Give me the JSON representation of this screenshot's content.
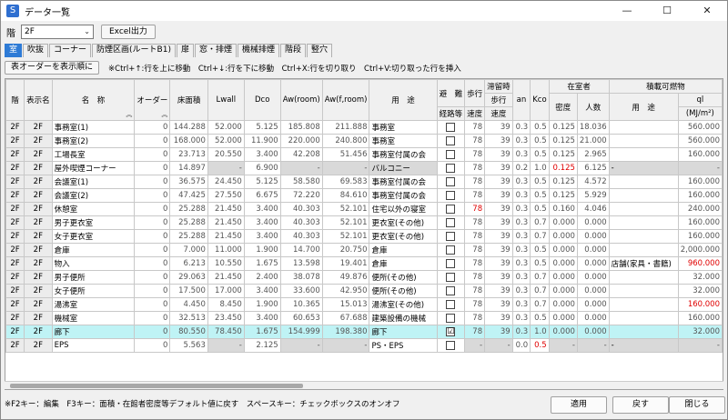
{
  "window": {
    "title": "データ一覧",
    "app_icon": "S"
  },
  "floor": {
    "label": "階",
    "value": "2F",
    "excel_label": "Excel出力"
  },
  "tabs": [
    "室",
    "吹抜",
    "コーナー",
    "防煙区画(ルートB1)",
    "扉",
    "窓・排煙",
    "機械排煙",
    "階段",
    "竪穴"
  ],
  "order_button": "表オーダーを表示順に",
  "hint": "※Ctrl+↑:行を上に移動　Ctrl+↓:行を下に移動　Ctrl+X:行を切り取り　Ctrl+V:切り取った行を挿入",
  "headers": {
    "kai": "階",
    "hyouji": "表示名",
    "meisho": "名　称",
    "order": "オーダー",
    "yuka": "床面積",
    "lwall": "Lwall",
    "dco": "Dco",
    "aw_room": "Aw(room)",
    "aw_froom": "Aw(f,room)",
    "yoto": "用　途",
    "hinan_top": "避　難",
    "keiro": "経路等",
    "hoko_top": "歩行",
    "hoko_bot": "速度",
    "tai_top": "滞留時",
    "tai_mid": "歩行",
    "tai_bot": "速度",
    "an": "an",
    "kco": "Kco",
    "zaishitsu": "在室者",
    "mitsudo": "密度",
    "ninzu": "人数",
    "sekisai": "積載可燃物",
    "sekisai_yoto": "用　途",
    "ql_top": "ql",
    "ql_unit": "(MJ/m²)"
  },
  "rows": [
    {
      "kai": "2F",
      "disp": "2F",
      "name": "事務室(1)",
      "order": "0",
      "yuka": "144.288",
      "lwall": "52.000",
      "dco": "5.125",
      "aw": "185.808",
      "awf": "211.888",
      "yoto": "事務室",
      "cb": "",
      "hoko": "78",
      "tai": "39",
      "an": "0.3",
      "kco": "0.5",
      "mitsudo": "0.125",
      "ninzu": "18.036",
      "s_yoto": "",
      "ql": "560.000"
    },
    {
      "kai": "2F",
      "disp": "2F",
      "name": "事務室(2)",
      "order": "0",
      "yuka": "168.000",
      "lwall": "52.000",
      "dco": "11.900",
      "aw": "220.000",
      "awf": "240.800",
      "yoto": "事務室",
      "cb": "",
      "hoko": "78",
      "tai": "39",
      "an": "0.3",
      "kco": "0.5",
      "mitsudo": "0.125",
      "ninzu": "21.000",
      "s_yoto": "",
      "ql": "560.000"
    },
    {
      "kai": "2F",
      "disp": "2F",
      "name": "工場長室",
      "order": "0",
      "yuka": "23.713",
      "lwall": "20.550",
      "dco": "3.400",
      "aw": "42.208",
      "awf": "51.456",
      "yoto": "事務室付属の会",
      "cb": "",
      "hoko": "78",
      "tai": "39",
      "an": "0.3",
      "kco": "0.5",
      "mitsudo": "0.125",
      "ninzu": "2.965",
      "s_yoto": "",
      "ql": "160.000"
    },
    {
      "kai": "2F",
      "disp": "2F",
      "name": "屋外喫煙コーナー",
      "order": "0",
      "yuka": "14.897",
      "lwall": "-",
      "dco": "6.900",
      "aw": "-",
      "awf": "-",
      "yoto": "バルコニー",
      "cb": "",
      "hoko": "78",
      "tai": "39",
      "an": "0.2",
      "kco": "1.0",
      "mitsudo": "0.125",
      "ninzu": "6.125",
      "s_yoto": "-",
      "ql": "-",
      "grey": true,
      "red_mitsudo": true
    },
    {
      "kai": "2F",
      "disp": "2F",
      "name": "会議室(1)",
      "order": "0",
      "yuka": "36.575",
      "lwall": "24.450",
      "dco": "5.125",
      "aw": "58.580",
      "awf": "69.583",
      "yoto": "事務室付属の会",
      "cb": "",
      "hoko": "78",
      "tai": "39",
      "an": "0.3",
      "kco": "0.5",
      "mitsudo": "0.125",
      "ninzu": "4.572",
      "s_yoto": "",
      "ql": "160.000"
    },
    {
      "kai": "2F",
      "disp": "2F",
      "name": "会議室(2)",
      "order": "0",
      "yuka": "47.425",
      "lwall": "27.550",
      "dco": "6.675",
      "aw": "72.220",
      "awf": "84.610",
      "yoto": "事務室付属の会",
      "cb": "",
      "hoko": "78",
      "tai": "39",
      "an": "0.3",
      "kco": "0.5",
      "mitsudo": "0.125",
      "ninzu": "5.929",
      "s_yoto": "",
      "ql": "160.000"
    },
    {
      "kai": "2F",
      "disp": "2F",
      "name": "休憩室",
      "order": "0",
      "yuka": "25.288",
      "lwall": "21.450",
      "dco": "3.400",
      "aw": "40.303",
      "awf": "52.101",
      "yoto": "住宅以外の寝室",
      "cb": "",
      "hoko": "78",
      "tai": "39",
      "an": "0.3",
      "kco": "0.5",
      "mitsudo": "0.160",
      "ninzu": "4.046",
      "s_yoto": "",
      "ql": "240.000",
      "red_hoko": true
    },
    {
      "kai": "2F",
      "disp": "2F",
      "name": "男子更衣室",
      "order": "0",
      "yuka": "25.288",
      "lwall": "21.450",
      "dco": "3.400",
      "aw": "40.303",
      "awf": "52.101",
      "yoto": "更衣室(その他)",
      "cb": "",
      "hoko": "78",
      "tai": "39",
      "an": "0.3",
      "kco": "0.7",
      "mitsudo": "0.000",
      "ninzu": "0.000",
      "s_yoto": "",
      "ql": "160.000"
    },
    {
      "kai": "2F",
      "disp": "2F",
      "name": "女子更衣室",
      "order": "0",
      "yuka": "25.288",
      "lwall": "21.450",
      "dco": "3.400",
      "aw": "40.303",
      "awf": "52.101",
      "yoto": "更衣室(その他)",
      "cb": "",
      "hoko": "78",
      "tai": "39",
      "an": "0.3",
      "kco": "0.7",
      "mitsudo": "0.000",
      "ninzu": "0.000",
      "s_yoto": "",
      "ql": "160.000"
    },
    {
      "kai": "2F",
      "disp": "2F",
      "name": "倉庫",
      "order": "0",
      "yuka": "7.000",
      "lwall": "11.000",
      "dco": "1.900",
      "aw": "14.700",
      "awf": "20.750",
      "yoto": "倉庫",
      "cb": "",
      "hoko": "78",
      "tai": "39",
      "an": "0.3",
      "kco": "0.5",
      "mitsudo": "0.000",
      "ninzu": "0.000",
      "s_yoto": "",
      "ql": "2,000.000"
    },
    {
      "kai": "2F",
      "disp": "2F",
      "name": "物入",
      "order": "0",
      "yuka": "6.213",
      "lwall": "10.550",
      "dco": "1.675",
      "aw": "13.598",
      "awf": "19.401",
      "yoto": "倉庫",
      "cb": "",
      "hoko": "78",
      "tai": "39",
      "an": "0.3",
      "kco": "0.5",
      "mitsudo": "0.000",
      "ninzu": "0.000",
      "s_yoto": "店舗(家具・書籍)",
      "ql": "960.000",
      "red_ql": true
    },
    {
      "kai": "2F",
      "disp": "2F",
      "name": "男子便所",
      "order": "0",
      "yuka": "29.063",
      "lwall": "21.450",
      "dco": "2.400",
      "aw": "38.078",
      "awf": "49.876",
      "yoto": "便所(その他)",
      "cb": "",
      "hoko": "78",
      "tai": "39",
      "an": "0.3",
      "kco": "0.7",
      "mitsudo": "0.000",
      "ninzu": "0.000",
      "s_yoto": "",
      "ql": "32.000"
    },
    {
      "kai": "2F",
      "disp": "2F",
      "name": "女子便所",
      "order": "0",
      "yuka": "17.500",
      "lwall": "17.000",
      "dco": "3.400",
      "aw": "33.600",
      "awf": "42.950",
      "yoto": "便所(その他)",
      "cb": "",
      "hoko": "78",
      "tai": "39",
      "an": "0.3",
      "kco": "0.7",
      "mitsudo": "0.000",
      "ninzu": "0.000",
      "s_yoto": "",
      "ql": "32.000"
    },
    {
      "kai": "2F",
      "disp": "2F",
      "name": "湯沸室",
      "order": "0",
      "yuka": "4.450",
      "lwall": "8.450",
      "dco": "1.900",
      "aw": "10.365",
      "awf": "15.013",
      "yoto": "湯沸室(その他)",
      "cb": "",
      "hoko": "78",
      "tai": "39",
      "an": "0.3",
      "kco": "0.7",
      "mitsudo": "0.000",
      "ninzu": "0.000",
      "s_yoto": "",
      "ql": "160.000",
      "red_ql": true
    },
    {
      "kai": "2F",
      "disp": "2F",
      "name": "機械室",
      "order": "0",
      "yuka": "32.513",
      "lwall": "23.450",
      "dco": "3.400",
      "aw": "60.653",
      "awf": "67.688",
      "yoto": "建築設備の機械",
      "cb": "",
      "hoko": "78",
      "tai": "39",
      "an": "0.3",
      "kco": "0.5",
      "mitsudo": "0.000",
      "ninzu": "0.000",
      "s_yoto": "",
      "ql": "160.000"
    },
    {
      "kai": "2F",
      "disp": "2F",
      "name": "廊下",
      "order": "0",
      "yuka": "80.550",
      "lwall": "78.450",
      "dco": "1.675",
      "aw": "154.999",
      "awf": "198.380",
      "yoto": "廊下",
      "cb": "☑",
      "hoko": "78",
      "tai": "39",
      "an": "0.3",
      "kco": "1.0",
      "mitsudo": "0.000",
      "ninzu": "0.000",
      "s_yoto": "",
      "ql": "32.000",
      "selected": true
    },
    {
      "kai": "2F",
      "disp": "2F",
      "name": "EPS",
      "order": "0",
      "yuka": "5.563",
      "lwall": "-",
      "dco": "2.125",
      "aw": "-",
      "awf": "-",
      "yoto": "PS・EPS",
      "cb": "",
      "hoko": "-",
      "tai": "-",
      "an": "0.0",
      "kco": "0.5",
      "mitsudo": "-",
      "ninzu": "-",
      "s_yoto": "-",
      "ql": "-",
      "eps": true
    }
  ],
  "status": "※F2キー：編集　F3キー：面積・在館者密度等デフォルト値に戻す　スペースキー：チェックボックスのオンオフ",
  "buttons": {
    "apply": "適用",
    "back": "戻す",
    "close": "閉じる"
  }
}
